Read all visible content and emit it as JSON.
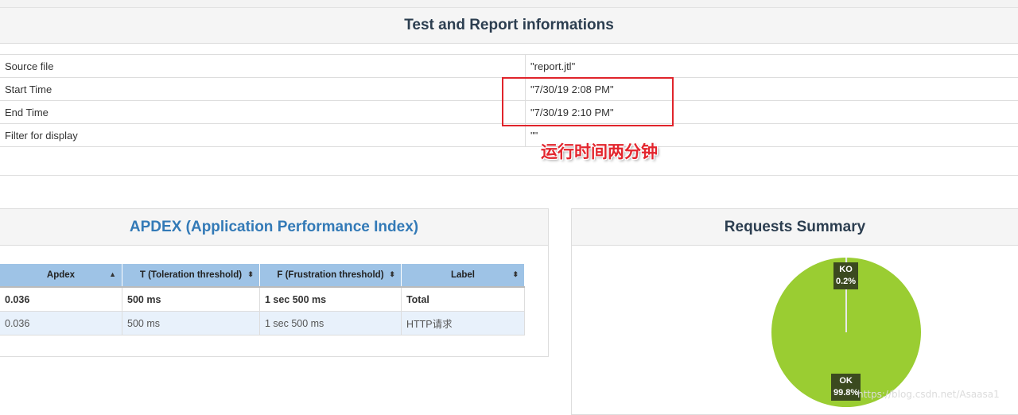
{
  "test_info": {
    "title": "Test and Report informations",
    "rows": [
      {
        "label": "Source file",
        "value": "\"report.jtl\""
      },
      {
        "label": "Start Time",
        "value": "\"7/30/19 2:08 PM\""
      },
      {
        "label": "End Time",
        "value": "\"7/30/19 2:10 PM\""
      },
      {
        "label": "Filter for display",
        "value": "\"\""
      }
    ],
    "annotation": "运行时间两分钟",
    "annotation_color": "#e3262e"
  },
  "apdex": {
    "title": "APDEX (Application Performance Index)",
    "columns": [
      "Apdex",
      "T (Toleration threshold)",
      "F (Frustration threshold)",
      "Label"
    ],
    "rows": [
      [
        "0.036",
        "500 ms",
        "1 sec 500 ms",
        "Total"
      ],
      [
        "0.036",
        "500 ms",
        "1 sec 500 ms",
        "HTTP请求"
      ]
    ],
    "header_color": "#9ec3e6"
  },
  "requests_summary": {
    "title": "Requests Summary",
    "ko": {
      "label": "KO",
      "pct": "0.2%",
      "value": 0.2
    },
    "ok": {
      "label": "OK",
      "pct": "99.8%",
      "value": 99.8
    },
    "ok_color": "#9acd32"
  },
  "watermark": "https://blog.csdn.net/Asaasa1"
}
